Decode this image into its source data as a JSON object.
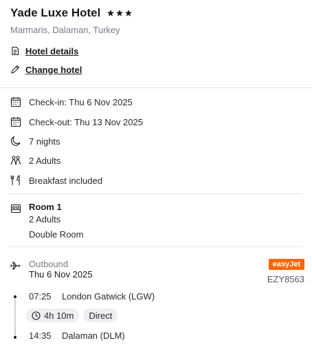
{
  "hotel": {
    "name": "Yade Luxe Hotel",
    "star_rating": 3,
    "location": "Marmaris, Dalaman, Turkey"
  },
  "links": {
    "hotel_details": "Hotel details",
    "change_hotel": "Change hotel"
  },
  "stay": {
    "check_in": "Check-in: Thu 6 Nov 2025",
    "check_out": "Check-out: Thu 13 Nov 2025",
    "nights": "7 nights",
    "guests": "2 Adults",
    "board": "Breakfast included"
  },
  "room": {
    "title": "Room 1",
    "guests": "2 Adults",
    "type": "Double Room"
  },
  "flight": {
    "label": "Outbound",
    "date": "Thu 6 Nov 2025",
    "airline": "easyJet",
    "airline_color": "#ff6600",
    "flight_number": "EZY8563",
    "departure_time": "07:25",
    "departure_airport": "London Gatwick (LGW)",
    "duration": "4h 10m",
    "stops": "Direct",
    "arrival_time": "14:35",
    "arrival_airport": "Dalaman (DLM)"
  },
  "icons": {
    "star": "star-icon",
    "document": "document-icon",
    "pencil": "pencil-icon",
    "calendar": "calendar-icon",
    "moon": "moon-icon",
    "people": "people-icon",
    "utensils": "utensils-icon",
    "bed": "bed-icon",
    "plane": "plane-icon",
    "clock": "clock-icon"
  }
}
